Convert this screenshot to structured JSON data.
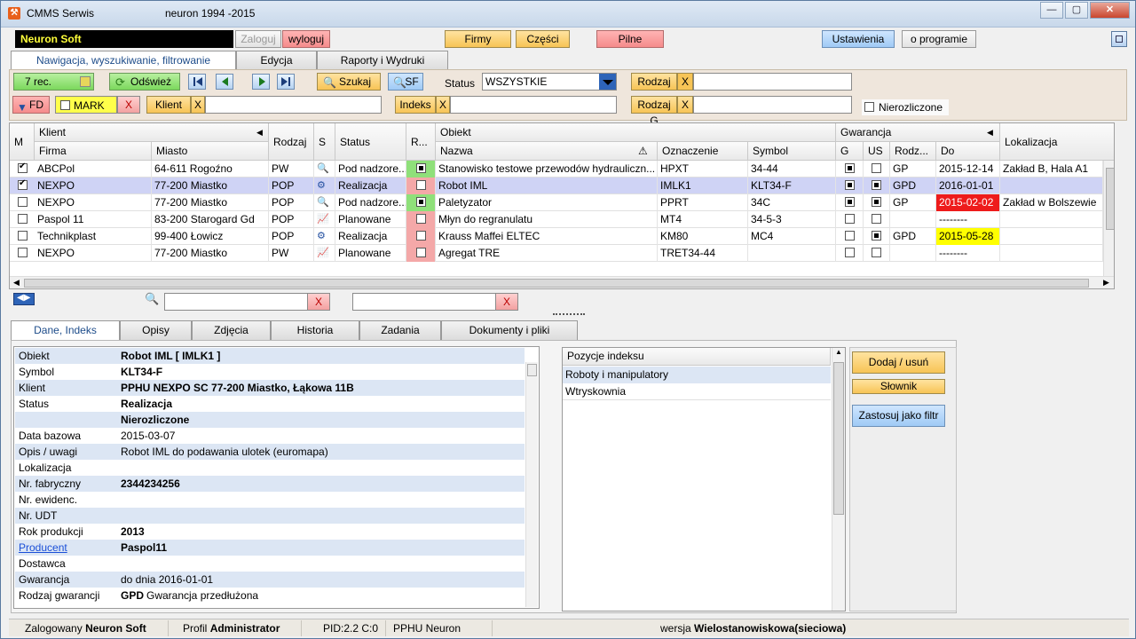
{
  "window": {
    "app_title": "CMMS Serwis",
    "subtitle": "neuron 1994 -2015",
    "min": "—",
    "max": "▢",
    "close": "✕"
  },
  "top": {
    "company": "Neuron Soft",
    "login": "Zaloguj",
    "logout": "wyloguj",
    "firms": "Firmy",
    "parts": "Części",
    "urgent": "Pilne",
    "settings": "Ustawienia",
    "about": "o programie"
  },
  "main_tabs": [
    "Nawigacja, wyszukiwanie, filtrowanie",
    "Edycja",
    "Raporty i Wydruki"
  ],
  "toolbar": {
    "records": "7 rec.",
    "refresh": "Odśwież",
    "search": "Szukaj",
    "sf": "SF",
    "status_label": "Status",
    "status_value": "WSZYSTKIE",
    "rodzaj": "Rodzaj",
    "x": "X",
    "fd": "FD",
    "mark": "MARK",
    "klient": "Klient",
    "indeks": "Indeks",
    "rodzaj_g": "Rodzaj G",
    "nierozliczone": "Nierozliczone"
  },
  "grid": {
    "group_headers": {
      "klient": "Klient",
      "obiekt": "Obiekt",
      "gwarancja": "Gwarancja"
    },
    "headers": {
      "m": "M",
      "firma": "Firma",
      "miasto": "Miasto",
      "rodzaj": "Rodzaj",
      "s": "S",
      "status": "Status",
      "r": "R...",
      "nazwa": "Nazwa",
      "oznaczenie": "Oznaczenie",
      "symbol": "Symbol",
      "g": "G",
      "us": "US",
      "rodz": "Rodz...",
      "do": "Do",
      "lokalizacja": "Lokalizacja"
    },
    "rows": [
      {
        "m": true,
        "firma": "ABCPol",
        "miasto": "64-611 Rogoźno",
        "rodzaj": "PW",
        "status": "Pod nadzore...",
        "r": "filled",
        "nazwa": "Stanowisko testowe przewodów hydrauliczn...",
        "ozn": "HPXT",
        "symbol": "34-44",
        "g": true,
        "us": false,
        "rodz": "GP",
        "do": "2015-12-14",
        "do_color": "",
        "lok": "Zakład B, Hala A1"
      },
      {
        "m": true,
        "firma": "NEXPO",
        "miasto": "77-200 Miastko",
        "rodzaj": "POP",
        "status": "Realizacja",
        "r": "empty",
        "nazwa": "Robot IML",
        "ozn": "IMLK1",
        "symbol": "KLT34-F",
        "g": true,
        "us": true,
        "rodz": "GPD",
        "do": "2016-01-01",
        "do_color": "",
        "lok": ""
      },
      {
        "m": false,
        "firma": "NEXPO",
        "miasto": "77-200 Miastko",
        "rodzaj": "POP",
        "status": "Pod nadzore...",
        "r": "filled",
        "nazwa": "Paletyzator",
        "ozn": "PPRT",
        "symbol": "34C",
        "g": true,
        "us": true,
        "rodz": "GP",
        "do": "2015-02-02",
        "do_color": "#ee1b1b",
        "lok": "Zakład w Bolszewie"
      },
      {
        "m": false,
        "firma": "Paspol 11",
        "miasto": "83-200 Starogard Gd",
        "rodzaj": "POP",
        "status": "Planowane",
        "r": "empty",
        "nazwa": "Młyn do regranulatu",
        "ozn": "MT4",
        "symbol": "34-5-3",
        "g": false,
        "us": false,
        "rodz": "",
        "do": "--------",
        "do_color": "",
        "lok": ""
      },
      {
        "m": false,
        "firma": "Technikplast",
        "miasto": "99-400 Łowicz",
        "rodzaj": "POP",
        "status": "Realizacja",
        "r": "empty",
        "nazwa": "Krauss Maffei ELTEC",
        "ozn": "KM80",
        "symbol": "MC4",
        "g": false,
        "us": true,
        "rodz": "GPD",
        "do": "2015-05-28",
        "do_color": "#ffff00",
        "lok": ""
      },
      {
        "m": false,
        "firma": "NEXPO",
        "miasto": "77-200 Miastko",
        "rodzaj": "PW",
        "status": "Planowane",
        "r": "empty",
        "nazwa": "Agregat TRE",
        "ozn": "TRET34-44",
        "symbol": "",
        "g": false,
        "us": false,
        "rodz": "",
        "do": "--------",
        "do_color": "",
        "lok": ""
      }
    ]
  },
  "bottom_tabs": [
    "Dane, Indeks",
    "Opisy",
    "Zdjęcia",
    "Historia",
    "Zadania",
    "Dokumenty i pliki"
  ],
  "details": [
    {
      "k": "Obiekt",
      "v": "Robot IML [ IMLK1 ]",
      "bold": true,
      "link": false
    },
    {
      "k": "Symbol",
      "v": "KLT34-F",
      "bold": true,
      "link": false
    },
    {
      "k": "Klient",
      "v": "PPHU NEXPO SC  77-200 Miastko, Łąkowa 11B",
      "bold": true,
      "link": false
    },
    {
      "k": "Status",
      "v": "Realizacja",
      "bold": true,
      "link": false
    },
    {
      "k": "",
      "v": "Nierozliczone",
      "bold": true,
      "link": false
    },
    {
      "k": "Data bazowa",
      "v": "2015-03-07",
      "bold": false,
      "link": false
    },
    {
      "k": "Opis / uwagi",
      "v": "Robot IML do podawania ulotek (euromapa)",
      "bold": false,
      "link": false
    },
    {
      "k": "Lokalizacja",
      "v": "",
      "bold": false,
      "link": false
    },
    {
      "k": "Nr. fabryczny",
      "v": "2344234256",
      "bold": true,
      "link": false
    },
    {
      "k": "Nr. ewidenc.",
      "v": "",
      "bold": false,
      "link": false
    },
    {
      "k": "Nr. UDT",
      "v": "",
      "bold": false,
      "link": false
    },
    {
      "k": "Rok produkcji",
      "v": "2013",
      "bold": true,
      "link": false
    },
    {
      "k": "Producent",
      "v": "Paspol11",
      "bold": true,
      "link": true
    },
    {
      "k": "Dostawca",
      "v": "",
      "bold": false,
      "link": false
    },
    {
      "k": "Gwarancja",
      "v": "do dnia 2016-01-01",
      "bold": false,
      "link": false
    },
    {
      "k": "Rodzaj gwarancji",
      "v": "GPD",
      "v2": "Gwarancja przedłużona",
      "bold": true,
      "link": false
    }
  ],
  "index": {
    "header": "Pozycje indeksu",
    "items": [
      "Roboty i manipulatory",
      "Wtryskownia"
    ]
  },
  "index_buttons": {
    "add_remove": "Dodaj / usuń",
    "dictionary": "Słownik",
    "apply_filter": "Zastosuj jako filtr"
  },
  "status_bar": {
    "logged_label": "Zalogowany",
    "logged_user": "Neuron Soft",
    "profile_label": "Profil",
    "profile": "Administrator",
    "pid": "PID:2.2 C:0",
    "company": "PPHU Neuron",
    "version_label": "wersja",
    "version": "Wielostanowiskowa(sieciowa)"
  },
  "colors": {
    "accent_blue": "#1d4c8a",
    "selected_row": "#cfd3f5",
    "status_red": "#ee1b1b",
    "status_yellow": "#ffff00"
  }
}
